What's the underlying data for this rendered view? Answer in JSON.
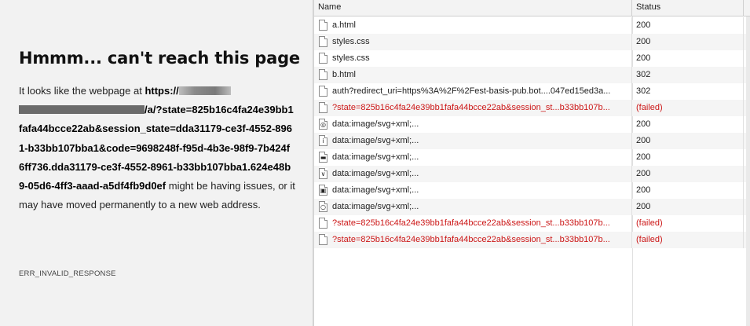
{
  "error_page": {
    "title": "Hmmm... can't reach this page",
    "body_prefix": "It looks like the webpage at ",
    "url_start": "https://",
    "url_after_redaction": "/a/?state=825b16c4fa24e39bb1fafa44bcce22ab&session_state=dda31179-ce3f-4552-8961-b33bb107bba1&code=9698248f-f95d-4b3e-98f9-7b424f6ff736.dda31179-ce3f-4552-8961-b33bb107bba1.624e48b9-05d6-4ff3-aaad-a5df4fb9d0ef",
    "body_suffix": " might be having issues, or it may have moved permanently to a new web address.",
    "error_code": "ERR_INVALID_RESPONSE"
  },
  "network": {
    "columns": {
      "name": "Name",
      "status": "Status"
    },
    "requests": [
      {
        "name": "a.html",
        "status": "200",
        "icon": "document-icon",
        "failed": false
      },
      {
        "name": "styles.css",
        "status": "200",
        "icon": "document-icon",
        "failed": false
      },
      {
        "name": "styles.css",
        "status": "200",
        "icon": "document-icon",
        "failed": false
      },
      {
        "name": "b.html",
        "status": "302",
        "icon": "document-icon",
        "failed": false
      },
      {
        "name": "auth?redirect_uri=https%3A%2F%2Fest-basis-pub.bot....047ed15ed3a...",
        "status": "302",
        "icon": "document-icon",
        "failed": false
      },
      {
        "name": "?state=825b16c4fa24e39bb1fafa44bcce22ab&session_st...b33bb107b...",
        "status": "(failed)",
        "icon": "document-icon",
        "failed": true
      },
      {
        "name": "data:image/svg+xml;...",
        "status": "200",
        "icon": "svg-globe-icon",
        "failed": false
      },
      {
        "name": "data:image/svg+xml;...",
        "status": "200",
        "icon": "svg-info-icon",
        "failed": false
      },
      {
        "name": "data:image/svg+xml;...",
        "status": "200",
        "icon": "svg-minus-icon",
        "failed": false
      },
      {
        "name": "data:image/svg+xml;...",
        "status": "200",
        "icon": "svg-chevron-icon",
        "failed": false
      },
      {
        "name": "data:image/svg+xml;...",
        "status": "200",
        "icon": "svg-box-icon",
        "failed": false
      },
      {
        "name": "data:image/svg+xml;...",
        "status": "200",
        "icon": "svg-search-icon",
        "failed": false
      },
      {
        "name": "?state=825b16c4fa24e39bb1fafa44bcce22ab&session_st...b33bb107b...",
        "status": "(failed)",
        "icon": "document-icon",
        "failed": true
      },
      {
        "name": "?state=825b16c4fa24e39bb1fafa44bcce22ab&session_st...b33bb107b...",
        "status": "(failed)",
        "icon": "document-icon",
        "failed": true
      }
    ]
  },
  "colors": {
    "failed": "#cc1717",
    "error_bg": "#f2f2f2",
    "header_bg": "#f3f3f3"
  }
}
